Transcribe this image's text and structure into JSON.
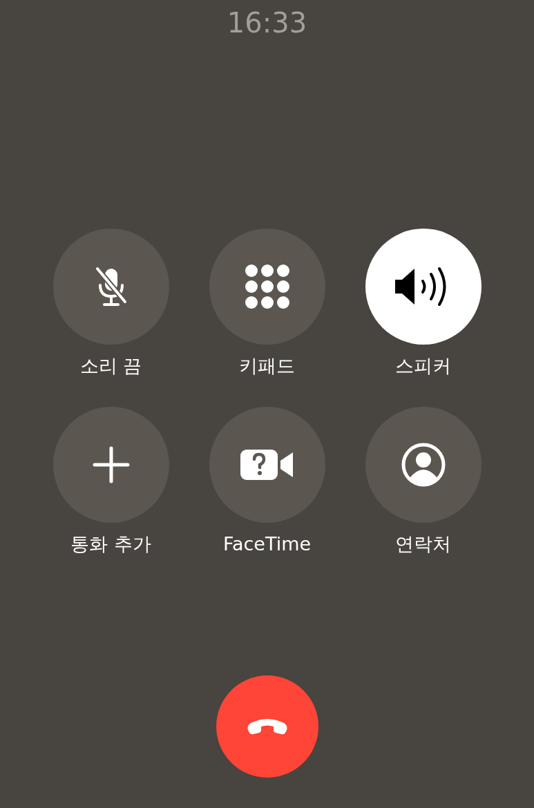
{
  "time": "16:33",
  "buttons": [
    {
      "kind": "mute",
      "label": "소리 끔",
      "selected": false
    },
    {
      "kind": "keypad",
      "label": "키패드",
      "selected": false
    },
    {
      "kind": "speaker",
      "label": "스피커",
      "selected": true
    },
    {
      "kind": "add",
      "label": "통화 추가",
      "selected": false
    },
    {
      "kind": "facetime",
      "label": "FaceTime",
      "selected": false
    },
    {
      "kind": "contacts",
      "label": "연락처",
      "selected": false
    }
  ],
  "end_call": {
    "kind": "hangup"
  }
}
